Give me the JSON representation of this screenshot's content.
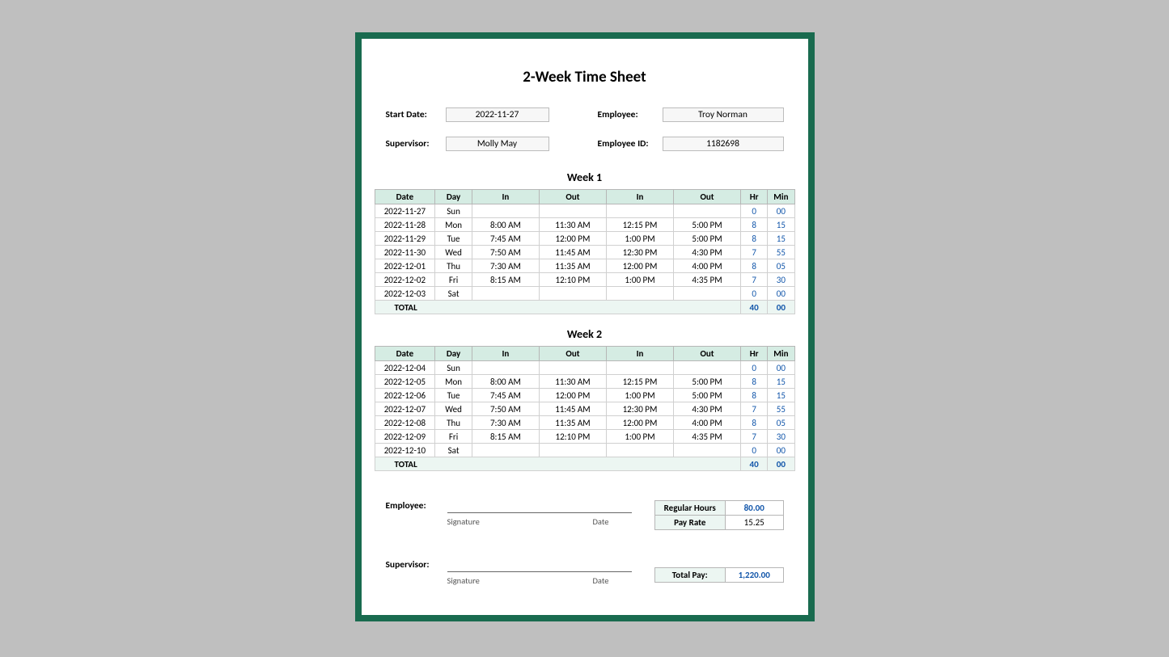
{
  "title": "2-Week Time Sheet",
  "info": {
    "start_date_label": "Start Date:",
    "start_date": "2022-11-27",
    "employee_label": "Employee:",
    "employee": "Troy Norman",
    "supervisor_label": "Supervisor:",
    "supervisor": "Molly May",
    "employee_id_label": "Employee ID:",
    "employee_id": "1182698"
  },
  "headers": {
    "date": "Date",
    "day": "Day",
    "in1": "In",
    "out1": "Out",
    "in2": "In",
    "out2": "Out",
    "hr": "Hr",
    "min": "Min",
    "total": "TOTAL"
  },
  "week1": {
    "title": "Week 1",
    "rows": [
      {
        "date": "2022-11-27",
        "day": "Sun",
        "in1": "",
        "out1": "",
        "in2": "",
        "out2": "",
        "hr": "0",
        "min": "00"
      },
      {
        "date": "2022-11-28",
        "day": "Mon",
        "in1": "8:00 AM",
        "out1": "11:30 AM",
        "in2": "12:15 PM",
        "out2": "5:00 PM",
        "hr": "8",
        "min": "15"
      },
      {
        "date": "2022-11-29",
        "day": "Tue",
        "in1": "7:45 AM",
        "out1": "12:00 PM",
        "in2": "1:00 PM",
        "out2": "5:00 PM",
        "hr": "8",
        "min": "15"
      },
      {
        "date": "2022-11-30",
        "day": "Wed",
        "in1": "7:50 AM",
        "out1": "11:45 AM",
        "in2": "12:30 PM",
        "out2": "4:30 PM",
        "hr": "7",
        "min": "55"
      },
      {
        "date": "2022-12-01",
        "day": "Thu",
        "in1": "7:30 AM",
        "out1": "11:35 AM",
        "in2": "12:00 PM",
        "out2": "4:00 PM",
        "hr": "8",
        "min": "05"
      },
      {
        "date": "2022-12-02",
        "day": "Fri",
        "in1": "8:15 AM",
        "out1": "12:10 PM",
        "in2": "1:00 PM",
        "out2": "4:35 PM",
        "hr": "7",
        "min": "30"
      },
      {
        "date": "2022-12-03",
        "day": "Sat",
        "in1": "",
        "out1": "",
        "in2": "",
        "out2": "",
        "hr": "0",
        "min": "00"
      }
    ],
    "total_hr": "40",
    "total_min": "00"
  },
  "week2": {
    "title": "Week 2",
    "rows": [
      {
        "date": "2022-12-04",
        "day": "Sun",
        "in1": "",
        "out1": "",
        "in2": "",
        "out2": "",
        "hr": "0",
        "min": "00"
      },
      {
        "date": "2022-12-05",
        "day": "Mon",
        "in1": "8:00 AM",
        "out1": "11:30 AM",
        "in2": "12:15 PM",
        "out2": "5:00 PM",
        "hr": "8",
        "min": "15"
      },
      {
        "date": "2022-12-06",
        "day": "Tue",
        "in1": "7:45 AM",
        "out1": "12:00 PM",
        "in2": "1:00 PM",
        "out2": "5:00 PM",
        "hr": "8",
        "min": "15"
      },
      {
        "date": "2022-12-07",
        "day": "Wed",
        "in1": "7:50 AM",
        "out1": "11:45 AM",
        "in2": "12:30 PM",
        "out2": "4:30 PM",
        "hr": "7",
        "min": "55"
      },
      {
        "date": "2022-12-08",
        "day": "Thu",
        "in1": "7:30 AM",
        "out1": "11:35 AM",
        "in2": "12:00 PM",
        "out2": "4:00 PM",
        "hr": "8",
        "min": "05"
      },
      {
        "date": "2022-12-09",
        "day": "Fri",
        "in1": "8:15 AM",
        "out1": "12:10 PM",
        "in2": "1:00 PM",
        "out2": "4:35 PM",
        "hr": "7",
        "min": "30"
      },
      {
        "date": "2022-12-10",
        "day": "Sat",
        "in1": "",
        "out1": "",
        "in2": "",
        "out2": "",
        "hr": "0",
        "min": "00"
      }
    ],
    "total_hr": "40",
    "total_min": "00"
  },
  "signatures": {
    "employee_label": "Employee:",
    "supervisor_label": "Supervisor:",
    "signature_hint": "Signature",
    "date_hint": "Date"
  },
  "pay": {
    "regular_hours_label": "Regular Hours",
    "regular_hours": "80.00",
    "pay_rate_label": "Pay Rate",
    "pay_rate": "15.25",
    "total_pay_label": "Total Pay:",
    "total_pay": "1,220.00"
  }
}
